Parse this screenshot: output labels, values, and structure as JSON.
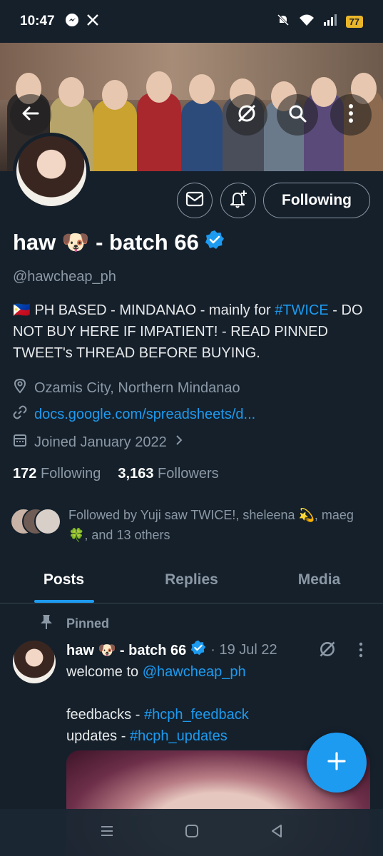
{
  "status_bar": {
    "time": "10:47",
    "battery": "77"
  },
  "profile": {
    "display_name": "haw 🐶 - batch 66",
    "handle": "@hawcheap_ph",
    "follow_state": "Following",
    "bio": {
      "part1": "🇵🇭 PH BASED - MINDANAO - mainly for ",
      "hashtag": "#TWICE",
      "part2": " - DO NOT BUY HERE IF IMPATIENT! - READ PINNED TWEET's THREAD BEFORE BUYING."
    },
    "location": "Ozamis City, Northern Mindanao",
    "website": "docs.google.com/spreadsheets/d...",
    "joined": "Joined January 2022",
    "following_count": "172",
    "following_label": "Following",
    "followers_count": "3,163",
    "followers_label": "Followers",
    "followed_by": "Followed by Yuji saw TWICE!, sheleena 💫, maeg 🍀, and 13 others"
  },
  "tabs": [
    {
      "label": "Posts",
      "active": true
    },
    {
      "label": "Replies",
      "active": false
    },
    {
      "label": "Media",
      "active": false
    }
  ],
  "pinned_tweet": {
    "pinned_label": "Pinned",
    "author": "haw 🐶 - batch 66",
    "date": "· 19 Jul 22",
    "line1_text": "welcome to ",
    "line1_mention": "@hawcheap_ph",
    "line2_text": "feedbacks - ",
    "line2_tag": "#hcph_feedback",
    "line3_text": "updates - ",
    "line3_tag": "#hcph_updates"
  },
  "colors": {
    "background": "#15202b",
    "accent": "#1d9bf0",
    "muted": "#8b98a5"
  },
  "icons": [
    "back-arrow-icon",
    "grok-icon",
    "search-icon",
    "more-vertical-icon",
    "message-icon",
    "notification-bell-icon",
    "verified-badge-icon",
    "location-icon",
    "link-icon",
    "calendar-icon",
    "pin-icon",
    "plus-icon"
  ]
}
